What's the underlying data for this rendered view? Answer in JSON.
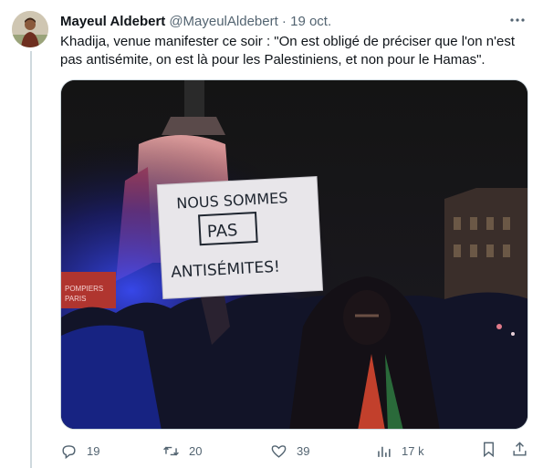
{
  "tweet": {
    "author_name": "Mayeul Aldebert",
    "handle": "@MayeulAldebert",
    "separator": " · ",
    "date": "19 oct.",
    "text": "Khadija, venue manifester ce soir : \"On est obligé de préciser que l'on n'est pas antisémite, on est là pour les Palestiniens, et non pour le Hamas\"."
  },
  "photo": {
    "sign_lines": [
      "NOUS SOMMES",
      "PAS",
      "ANTISÉMITES!"
    ],
    "background_sign": [
      "POMPIERS",
      "PARIS"
    ]
  },
  "actions": {
    "replies": "19",
    "retweets": "20",
    "likes": "39",
    "views": "17 k"
  },
  "icons": {
    "more": "more-icon",
    "reply": "reply-icon",
    "retweet": "retweet-icon",
    "like": "heart-icon",
    "views": "views-icon",
    "bookmark": "bookmark-icon",
    "share": "share-icon"
  },
  "colors": {
    "text": "#0f1419",
    "muted": "#536471",
    "border": "#cfd9de"
  }
}
